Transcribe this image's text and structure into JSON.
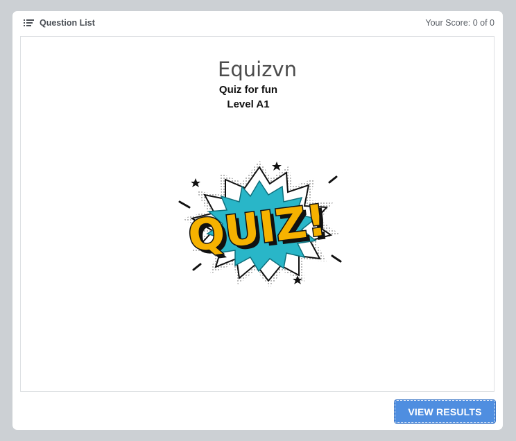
{
  "header": {
    "question_list_label": "Question List",
    "score_text": "Your Score: 0 of 0"
  },
  "quiz": {
    "title": "Equizvn",
    "subtitle_line1": "Quiz for fun",
    "subtitle_line2": "Level A1",
    "logo_text": "QUIZ!"
  },
  "footer": {
    "view_results_label": "VIEW RESULTS"
  },
  "colors": {
    "page_background": "#ccd0d4",
    "button_blue": "#4f8ee0",
    "logo_yellow": "#f6b200",
    "logo_cyan": "#29b6c8"
  },
  "icons": {
    "question_list": "list-icon",
    "logo": "quiz-comic-logo"
  }
}
